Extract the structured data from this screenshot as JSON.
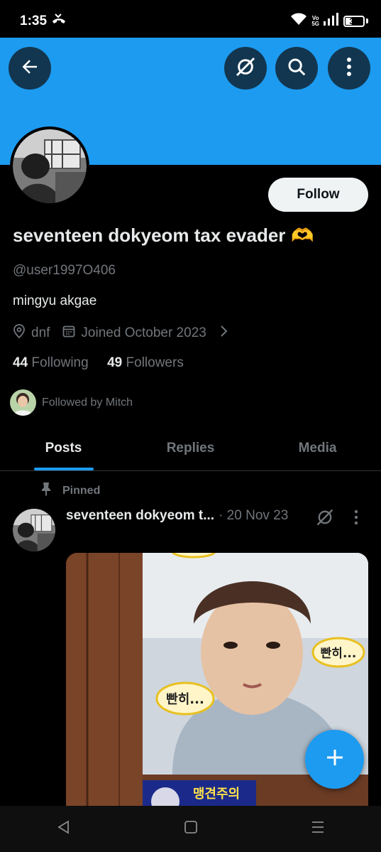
{
  "status_bar": {
    "time": "1:35",
    "volte_top": "Vo",
    "volte_bottom": "5G",
    "battery": "39",
    "battery_level": 0.39
  },
  "colors": {
    "banner": "#1d9bf0",
    "accent": "#1d9bf0",
    "text_primary": "#e7e9ea",
    "text_secondary": "#71767b",
    "background": "#000000"
  },
  "header": {
    "back_icon": "arrow-left-icon",
    "grok_icon": "grok-icon",
    "search_icon": "search-icon",
    "more_icon": "more-vertical-icon"
  },
  "profile": {
    "follow_label": "Follow",
    "display_name": "seventeen dokyeom tax evader",
    "name_emoji": "🫶",
    "handle": "@user1997O406",
    "bio": "mingyu akgae",
    "location": "dnf",
    "joined": "Joined October 2023",
    "following_count": "44",
    "following_label": "Following",
    "followers_count": "49",
    "followers_label": "Followers",
    "followed_by": "Followed by Mitch"
  },
  "tabs": [
    {
      "label": "Posts",
      "active": true
    },
    {
      "label": "Replies",
      "active": false
    },
    {
      "label": "Media",
      "active": false
    }
  ],
  "post": {
    "pinned_label": "Pinned",
    "author_name": "seventeen dokyeom t...",
    "date": "· 20 Nov 23",
    "sticker_text": "빤히...",
    "sign_text": "맹견주의"
  },
  "fab_icon": "plus-icon",
  "nav": {
    "back_icon": "triangle-back-icon",
    "home_icon": "square-home-icon",
    "recents_icon": "menu-lines-icon"
  }
}
